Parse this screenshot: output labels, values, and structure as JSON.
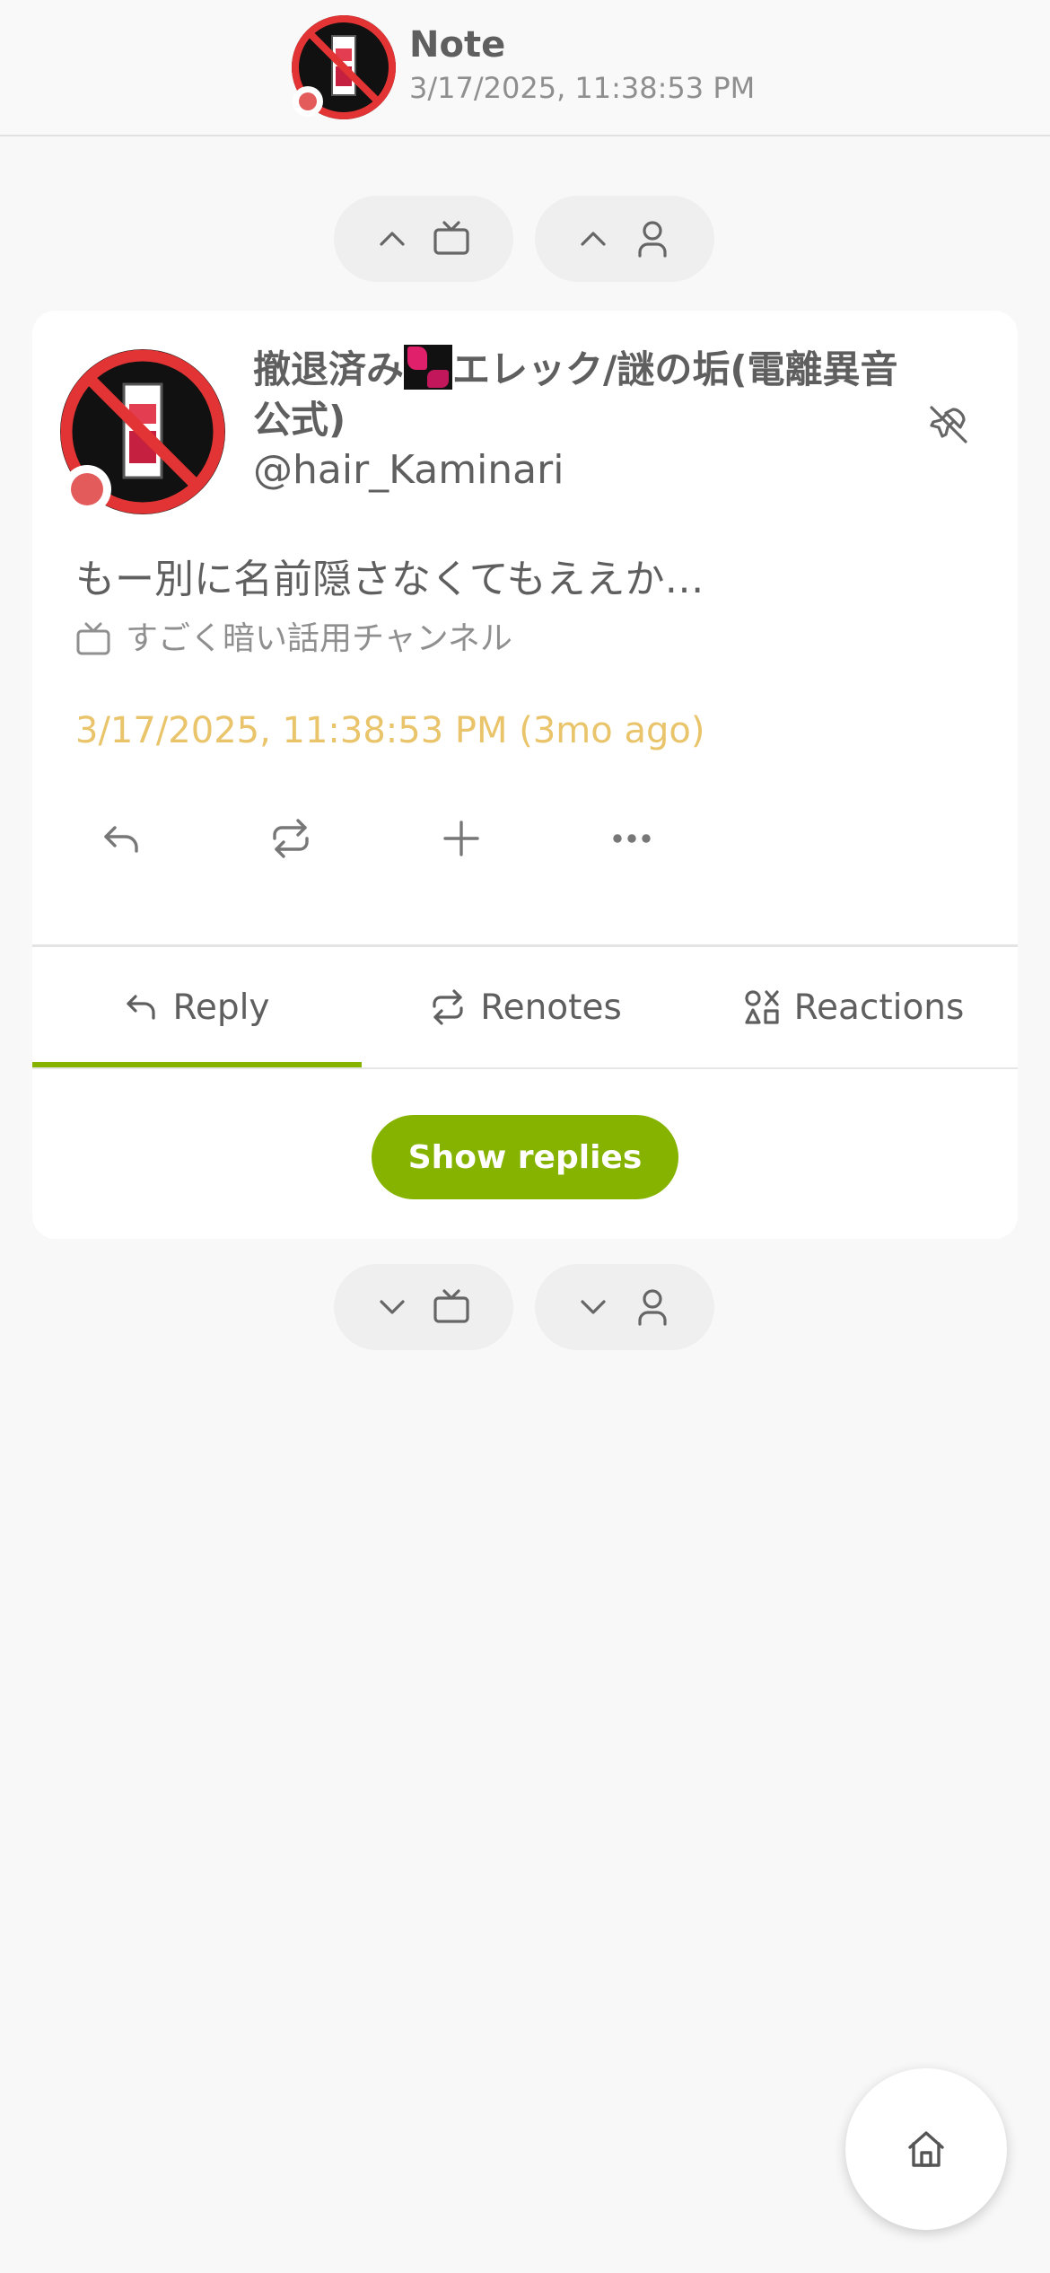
{
  "header": {
    "title": "Note",
    "subtitle": "3/17/2025, 11:38:53 PM",
    "avatar_icon": "no-bottle-avatar"
  },
  "nav_top": [
    {
      "icon_direction": "chevron-up-icon",
      "icon": "tv-icon"
    },
    {
      "icon_direction": "chevron-up-icon",
      "icon": "user-icon"
    }
  ],
  "nav_bottom": [
    {
      "icon_direction": "chevron-down-icon",
      "icon": "tv-icon"
    },
    {
      "icon_direction": "chevron-down-icon",
      "icon": "user-icon"
    }
  ],
  "note": {
    "display_name_prefix": "撤退済み",
    "display_name_suffix": "エレック/謎の垢(電離異音公式)",
    "username": "@hair_Kaminari",
    "text": "もー別に名前隠さなくてもええか…",
    "channel": "すごく暗い話用チャンネル",
    "timestamp": "3/17/2025, 11:38:53 PM (3mo ago)"
  },
  "actions": [
    "reply-icon",
    "renote-icon",
    "plus-icon",
    "more-icon"
  ],
  "tabs": [
    {
      "label": "Reply",
      "icon": "reply-icon",
      "active": true
    },
    {
      "label": "Renotes",
      "icon": "renote-icon",
      "active": false
    },
    {
      "label": "Reactions",
      "icon": "reactions-icon",
      "active": false
    }
  ],
  "show_replies_label": "Show replies",
  "colors": {
    "accent": "#86b300",
    "timestamp": "#e9c46a",
    "online": "#e35b5b"
  }
}
